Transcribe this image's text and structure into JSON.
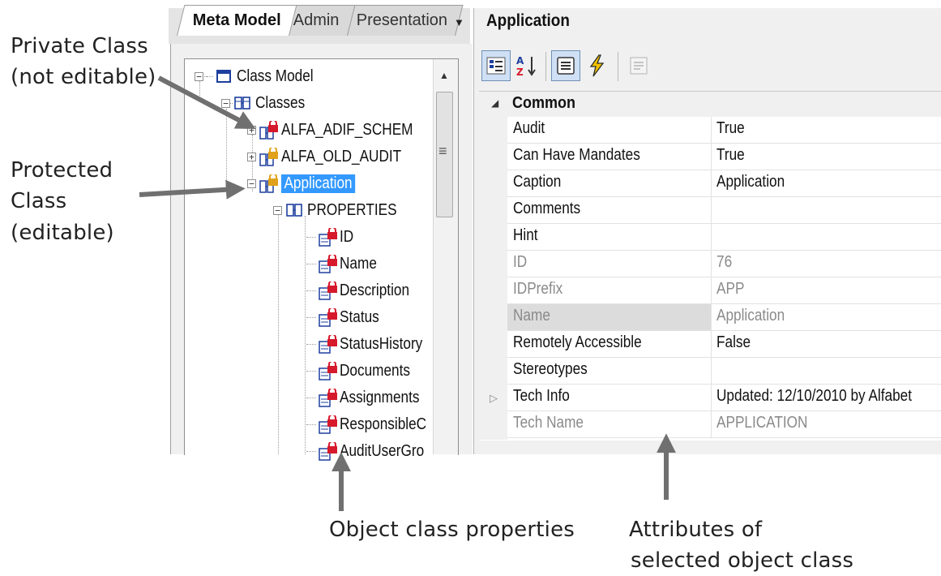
{
  "annotations": {
    "private_class": "Private Class",
    "private_class_note": "(not editable)",
    "protected_class_1": "Protected",
    "protected_class_2": "Class",
    "protected_class_3": "(editable)",
    "object_class_properties": "Object class properties",
    "attributes_1": "Attributes  of",
    "attributes_2": "selected object class"
  },
  "tabs": [
    {
      "label": "Meta Model",
      "active": true
    },
    {
      "label": "Admin",
      "active": false
    },
    {
      "label": "Presentation",
      "active": false
    }
  ],
  "tabs_dropdown_glyph": "▼",
  "tree": {
    "root": "Class Model",
    "classes": "Classes",
    "class_items": [
      {
        "label": "ALFA_ADIF_SCHEM",
        "lock": "red"
      },
      {
        "label": "ALFA_OLD_AUDIT",
        "lock": "yellow"
      },
      {
        "label": "Application",
        "lock": "yellow",
        "selected": true
      }
    ],
    "properties_folder": "PROPERTIES",
    "properties": [
      "ID",
      "Name",
      "Description",
      "Status",
      "StatusHistory",
      "Documents",
      "Assignments",
      "ResponsibleC",
      "AuditUserGro"
    ]
  },
  "grid": {
    "title": "Application",
    "category": "Common",
    "rows": [
      {
        "name": "Audit",
        "value": "True",
        "readonly": false
      },
      {
        "name": "Can Have Mandates",
        "value": "True",
        "readonly": false
      },
      {
        "name": "Caption",
        "value": "Application",
        "readonly": false
      },
      {
        "name": "Comments",
        "value": "",
        "readonly": false
      },
      {
        "name": "Hint",
        "value": "",
        "readonly": false
      },
      {
        "name": "ID",
        "value": "76",
        "readonly": true
      },
      {
        "name": "IDPrefix",
        "value": "APP",
        "readonly": true
      },
      {
        "name": "Name",
        "value": "Application",
        "readonly": true,
        "highlighted": true
      },
      {
        "name": "Remotely Accessible",
        "value": "False",
        "readonly": false
      },
      {
        "name": "Stereotypes",
        "value": "",
        "readonly": false
      },
      {
        "name": "Tech Info",
        "value": "Updated: 12/10/2010 by Alfabet",
        "readonly": false,
        "expandable": true
      },
      {
        "name": "Tech Name",
        "value": "APPLICATION",
        "readonly": true
      }
    ]
  },
  "colors": {
    "selection": "#3399ff",
    "lock_red": "#d6192b",
    "lock_yellow": "#e0a11b",
    "class_icon": "#1d3f9e",
    "arrow": "#707070"
  }
}
